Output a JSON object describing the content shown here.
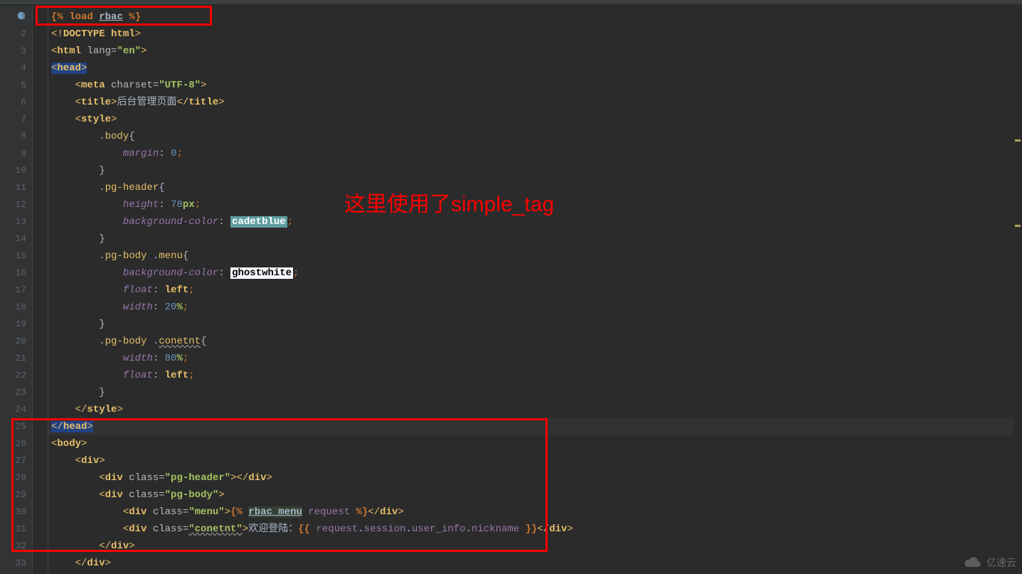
{
  "annotation": "这里使用了simple_tag",
  "watermark": "亿速云",
  "gutter": [
    "1",
    "2",
    "3",
    "4",
    "5",
    "6",
    "7",
    "8",
    "9",
    "10",
    "11",
    "12",
    "13",
    "14",
    "15",
    "16",
    "17",
    "18",
    "19",
    "20",
    "21",
    "22",
    "23",
    "24",
    "25",
    "26",
    "27",
    "28",
    "29",
    "30",
    "31",
    "32",
    "33"
  ],
  "code": {
    "l1": {
      "a": "{% ",
      "b": "load ",
      "c": "rbac",
      "d": " %}"
    },
    "l2": {
      "a": "<!",
      "b": "DOCTYPE ",
      "c": "html",
      "d": ">"
    },
    "l3": {
      "a": "<",
      "b": "html ",
      "c": "lang=",
      "d": "\"en\"",
      "e": ">"
    },
    "l4": {
      "a": "<",
      "b": "head",
      "c": ">"
    },
    "l5": {
      "a": "    <",
      "b": "meta ",
      "c": "charset=",
      "d": "\"UTF-8\"",
      "e": ">"
    },
    "l6": {
      "a": "    <",
      "b": "title",
      "c": ">",
      "d": "后台管理页面",
      "e": "</",
      "f": "title",
      "g": ">"
    },
    "l7": {
      "a": "    <",
      "b": "style",
      "c": ">"
    },
    "l8": {
      "a": "        .",
      "b": "body",
      "c": "{"
    },
    "l9": {
      "a": "            ",
      "b": "margin",
      "c": ": ",
      "d": "0",
      "e": ";"
    },
    "l10": {
      "a": "        }",
      "b": ""
    },
    "l11": {
      "a": "        .",
      "b": "pg-header",
      "c": "{"
    },
    "l12": {
      "a": "            ",
      "b": "height",
      "c": ": ",
      "d": "78",
      "e": "px",
      "f": ";"
    },
    "l13": {
      "a": "            ",
      "b": "background-color",
      "c": ": ",
      "d": "cadetblue",
      "e": ";"
    },
    "l14": {
      "a": "        }",
      "b": ""
    },
    "l15": {
      "a": "        .",
      "b": "pg-body ",
      "c": ".",
      "d": "menu",
      "e": "{"
    },
    "l16": {
      "a": "            ",
      "b": "background-color",
      "c": ": ",
      "d": "ghostwhite",
      "e": ";"
    },
    "l17": {
      "a": "            ",
      "b": "float",
      "c": ": ",
      "d": "left",
      "e": ";"
    },
    "l18": {
      "a": "            ",
      "b": "width",
      "c": ": ",
      "d": "20",
      "e": "%",
      "f": ";"
    },
    "l19": {
      "a": "        }",
      "b": ""
    },
    "l20": {
      "a": "        .",
      "b": "pg-body ",
      "c": ".",
      "d": "conetnt",
      "e": "{"
    },
    "l21": {
      "a": "            ",
      "b": "width",
      "c": ": ",
      "d": "80",
      "e": "%",
      "f": ";"
    },
    "l22": {
      "a": "            ",
      "b": "float",
      "c": ": ",
      "d": "left",
      "e": ";"
    },
    "l23": {
      "a": "        }",
      "b": ""
    },
    "l24": {
      "a": "    </",
      "b": "style",
      "c": ">"
    },
    "l25": {
      "a": "</",
      "b": "head",
      "c": ">"
    },
    "l26": {
      "a": "<",
      "b": "body",
      "c": ">"
    },
    "l27": {
      "a": "    <",
      "b": "div",
      "c": ">"
    },
    "l28": {
      "a": "        <",
      "b": "div ",
      "c": "class=",
      "d": "\"pg-header\"",
      "e": "></",
      "f": "div",
      "g": ">"
    },
    "l29": {
      "a": "        <",
      "b": "div ",
      "c": "class=",
      "d": "\"pg-body\"",
      "e": ">"
    },
    "l30": {
      "a": "            <",
      "b": "div ",
      "c": "class=",
      "d": "\"menu\"",
      "e": ">",
      "f": "{% ",
      "g": "rbac_menu",
      "h": " request ",
      "i": "%}",
      "j": "</",
      "k": "div",
      "l": ">"
    },
    "l31": {
      "a": "            <",
      "b": "div ",
      "c": "class=",
      "d": "\"conetnt\"",
      "e": ">",
      "f": "欢迎登陆：",
      "g": "{{ ",
      "h": "request",
      "i": ".",
      "j": "session",
      "k": ".",
      "l": "user_info",
      "m": ".",
      "n": "nickname",
      "o": " }}",
      "p": "</",
      "q": "div",
      "r": ">"
    },
    "l32": {
      "a": "        </",
      "b": "div",
      "c": ">"
    },
    "l33": {
      "a": "    </",
      "b": "div",
      "c": ">"
    }
  }
}
